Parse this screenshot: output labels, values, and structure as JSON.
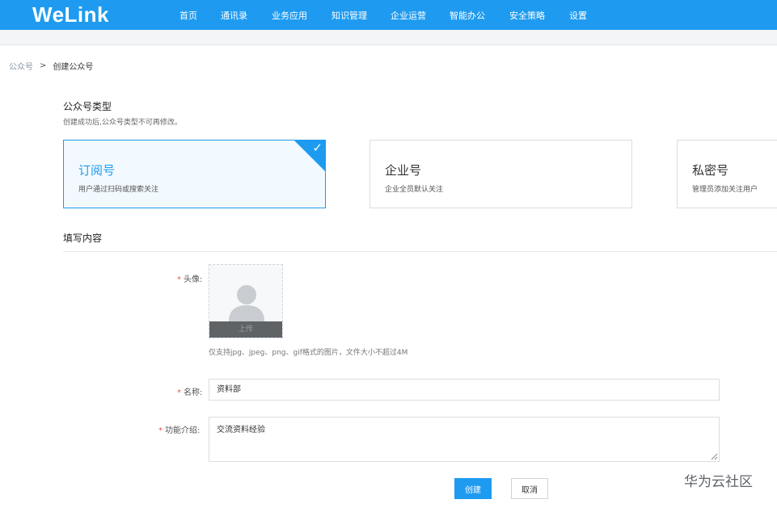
{
  "header": {
    "logo": "WeLink",
    "nav": [
      "首页",
      "通讯录",
      "业务应用",
      "知识管理",
      "企业运营",
      "智能办公",
      "安全策略",
      "设置"
    ]
  },
  "breadcrumb": {
    "parent": "公众号",
    "separator": ">",
    "current": "创建公众号"
  },
  "type_section": {
    "title": "公众号类型",
    "subtitle": "创建成功后,公众号类型不可再修改。",
    "cards": [
      {
        "name": "订阅号",
        "desc": "用户通过扫码或搜索关注",
        "selected": true
      },
      {
        "name": "企业号",
        "desc": "企业全员默认关注",
        "selected": false
      },
      {
        "name": "私密号",
        "desc": "管理员添加关注用户",
        "selected": false
      }
    ]
  },
  "fill_section": {
    "title": "填写内容"
  },
  "form": {
    "required_mark": "*",
    "avatar_label": "头像:",
    "upload_label": "上传",
    "avatar_hint": "仅支持jpg、jpeg、png、gif格式的图片，文件大小不超过4M",
    "name_label": "名称:",
    "name_value": "资料部",
    "intro_label": "功能介绍:",
    "intro_value": "交流资料经验"
  },
  "actions": {
    "create": "创建",
    "cancel": "取消"
  },
  "watermark": "华为云社区",
  "colors": {
    "primary": "#1e9bf0",
    "required": "#f05454"
  }
}
